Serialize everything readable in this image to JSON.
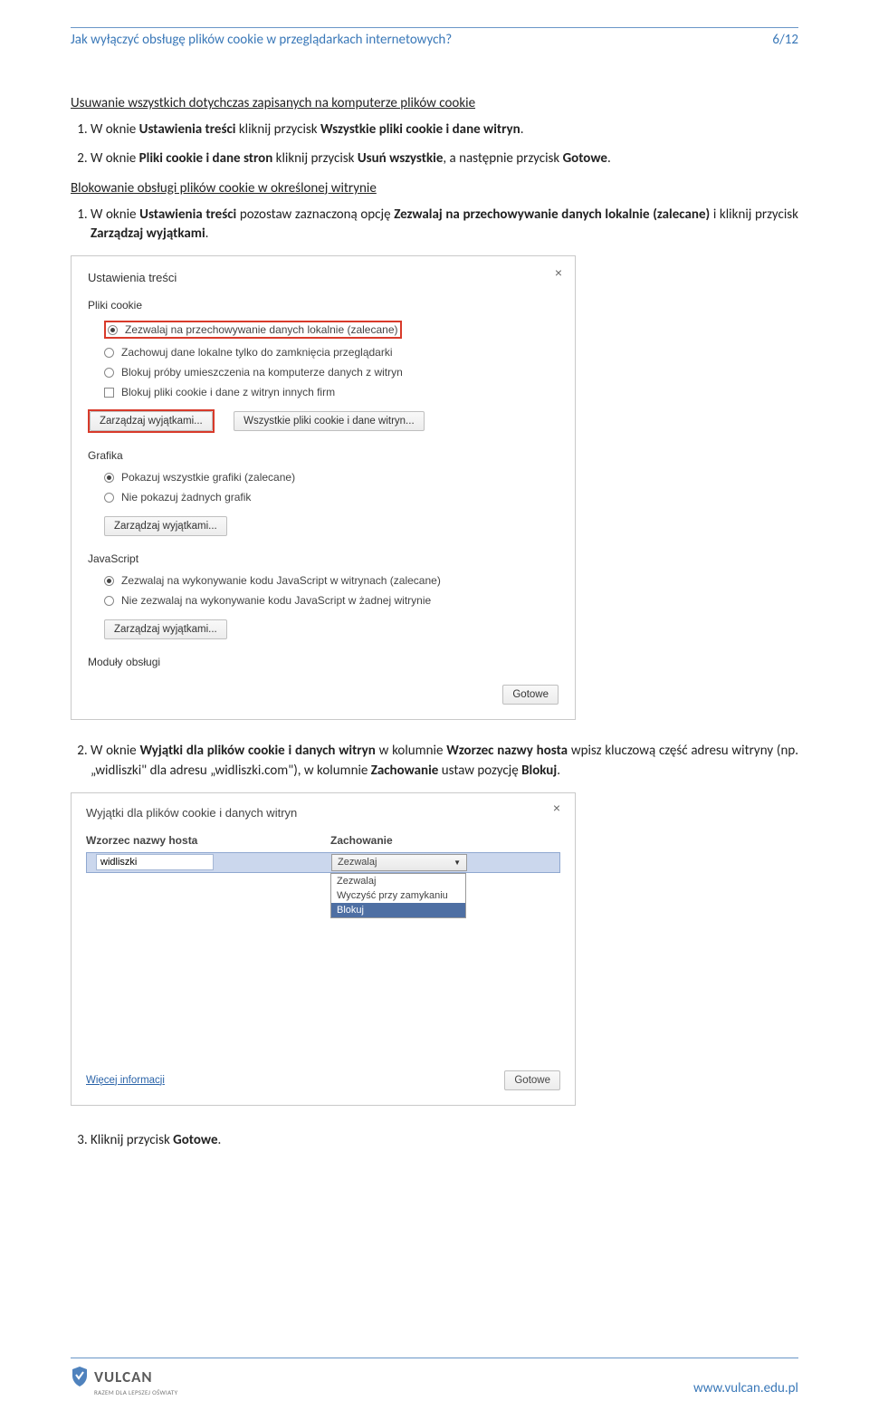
{
  "header": {
    "title": "Jak wyłączyć obsługę plików cookie w przeglądarkach internetowych?",
    "page": "6/12"
  },
  "sect1": {
    "title": "Usuwanie wszystkich dotychczas zapisanych na komputerze plików cookie",
    "li1_pre": "W oknie ",
    "li1_b1": "Ustawienia treści",
    "li1_mid": " kliknij przycisk ",
    "li1_b2": "Wszystkie pliki cookie i dane witryn",
    "li1_post": ".",
    "li2_pre": "W oknie ",
    "li2_b1": "Pliki cookie i dane stron",
    "li2_mid1": " kliknij przycisk ",
    "li2_b2": "Usuń wszystkie",
    "li2_mid2": ", a następnie przycisk ",
    "li2_b3": "Gotowe",
    "li2_post": "."
  },
  "sect2": {
    "title": "Blokowanie obsługi plików cookie w określonej witrynie",
    "li1_pre": "W oknie ",
    "li1_b1": "Ustawienia treści",
    "li1_mid1": " pozostaw zaznaczoną opcję ",
    "li1_b2": "Zezwalaj na przechowywanie danych lokalnie (zalecane)",
    "li1_mid2": " i kliknij przycisk ",
    "li1_b3": "Zarządzaj wyjątkami",
    "li1_post": "."
  },
  "shot": {
    "title": "Ustawienia treści",
    "cookies": {
      "title": "Pliki cookie",
      "o1": "Zezwalaj na przechowywanie danych lokalnie (zalecane)",
      "o2": "Zachowuj dane lokalne tylko do zamknięcia przeglądarki",
      "o3": "Blokuj próby umieszczenia na komputerze danych z witryn",
      "o4": "Blokuj pliki cookie i dane z witryn innych firm",
      "b1": "Zarządzaj wyjątkami...",
      "b2": "Wszystkie pliki cookie i dane witryn..."
    },
    "gfx": {
      "title": "Grafika",
      "o1": "Pokazuj wszystkie grafiki (zalecane)",
      "o2": "Nie pokazuj żadnych grafik",
      "b1": "Zarządzaj wyjątkami..."
    },
    "js": {
      "title": "JavaScript",
      "o1": "Zezwalaj na wykonywanie kodu JavaScript w witrynach (zalecane)",
      "o2": "Nie zezwalaj na wykonywanie kodu JavaScript w żadnej witrynie",
      "b1": "Zarządzaj wyjątkami..."
    },
    "plugins": {
      "title": "Moduły obsługi"
    },
    "done": "Gotowe"
  },
  "after": {
    "li2_pre": "W oknie ",
    "li2_b1": "Wyjątki dla plików cookie i danych witryn",
    "li2_mid1": " w kolumnie ",
    "li2_b2": "Wzorzec nazwy hosta",
    "li2_mid2": " wpisz kluczową część adresu witryny (np. „widliszki\" dla adresu „widliszki.com\"), w kolumnie ",
    "li2_b3": "Zachowanie",
    "li2_mid3": " ustaw pozycję ",
    "li2_b4": "Blokuj",
    "li2_post": "."
  },
  "shot2": {
    "title": "Wyjątki dla plików cookie i danych witryn",
    "col1": "Wzorzec nazwy hosta",
    "col2": "Zachowanie",
    "input": "widliszki",
    "ddsel": "Zezwalaj",
    "m1": "Zezwalaj",
    "m2": "Wyczyść przy zamykaniu",
    "m3": "Blokuj",
    "more": "Więcej informacji",
    "done": "Gotowe"
  },
  "final": {
    "li3_pre": "Kliknij przycisk ",
    "li3_b": "Gotowe",
    "li3_post": "."
  },
  "footer": {
    "brand": "VULCAN",
    "tag": "RAZEM DLA LEPSZEJ OŚWIATY",
    "url": "www.vulcan.edu.pl"
  }
}
